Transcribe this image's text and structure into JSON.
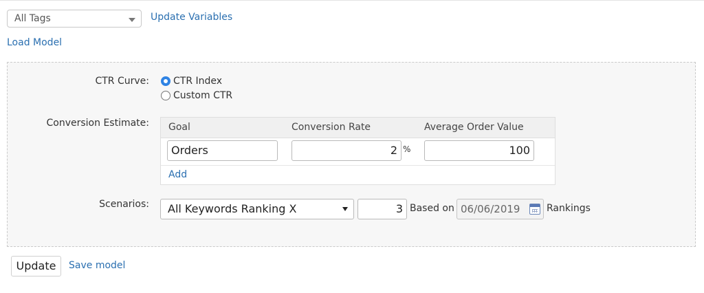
{
  "tags": {
    "selected": "All Tags"
  },
  "links": {
    "update_variables": "Update Variables",
    "load_model": "Load Model",
    "save_model": "Save model",
    "add": "Add"
  },
  "ctr_curve": {
    "label": "CTR Curve:",
    "options": [
      {
        "label": "CTR Index",
        "checked": true
      },
      {
        "label": "Custom CTR",
        "checked": false
      }
    ]
  },
  "conversion": {
    "label": "Conversion Estimate:",
    "headers": [
      "Goal",
      "Conversion Rate",
      "Average Order Value"
    ],
    "row": {
      "goal": "Orders",
      "rate": "2",
      "rate_unit": "%",
      "aov": "100"
    }
  },
  "scenarios": {
    "label": "Scenarios:",
    "selected": "All Keywords Ranking X",
    "count": "3",
    "based_on": "Based on",
    "date": "06/06/2019",
    "rankings": "Rankings"
  },
  "actions": {
    "update": "Update"
  },
  "colors": {
    "link": "#2a6fb0",
    "radio_checked": "#2f83e4",
    "panel_bg": "#f7f7f7"
  }
}
